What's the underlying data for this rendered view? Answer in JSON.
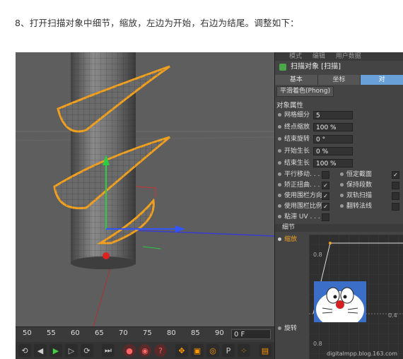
{
  "instruction": "8、打开扫描对象中细节，缩放，左边为开始，右边为结尾。调整如下：",
  "panel": {
    "menu": [
      "模式",
      "编辑",
      "用户数据"
    ],
    "object_title": "扫描对象 [扫描]",
    "tabs": [
      "基本",
      "坐标",
      "对"
    ],
    "phong_tab": "平滑着色(Phong)",
    "section_title": "对象属性",
    "fields": [
      {
        "label": "网格细分",
        "value": "5"
      },
      {
        "label": "终点缩放",
        "value": "100 %"
      },
      {
        "label": "结束旋转",
        "value": "0 °"
      },
      {
        "label": "开始生长",
        "value": "0 %"
      },
      {
        "label": "结束生长",
        "value": "100 %"
      }
    ],
    "checks_left": [
      {
        "label": "平行移动. . . .",
        "checked": false
      },
      {
        "label": "矫正扭曲. . .",
        "checked": true
      },
      {
        "label": "使用围栏方向",
        "checked": true
      },
      {
        "label": "使用围栏比例",
        "checked": true
      },
      {
        "label": "粘滞 UV . . . .",
        "checked": false
      }
    ],
    "checks_right": [
      {
        "label": "恒定截面",
        "checked": true
      },
      {
        "label": "保持段数",
        "checked": false
      },
      {
        "label": "双轨扫描",
        "checked": false
      },
      {
        "label": "翻转法线",
        "checked": false
      }
    ],
    "detail_title": "细节",
    "scale_label": "缩放",
    "rotate_label": "旋转",
    "graph_value_1": "0.8",
    "graph_value_2": "0.4",
    "graph_value_3": "0.8"
  },
  "timeline": {
    "ticks": [
      "50",
      "55",
      "60",
      "65",
      "70",
      "75",
      "80",
      "85",
      "90"
    ],
    "frame": "0 F"
  },
  "watermark": "digitalmpp.blog.163.com",
  "colors": {
    "accent": "#6aa0d8",
    "spline": "#f0a020",
    "viewport": "#5e5e5e"
  }
}
